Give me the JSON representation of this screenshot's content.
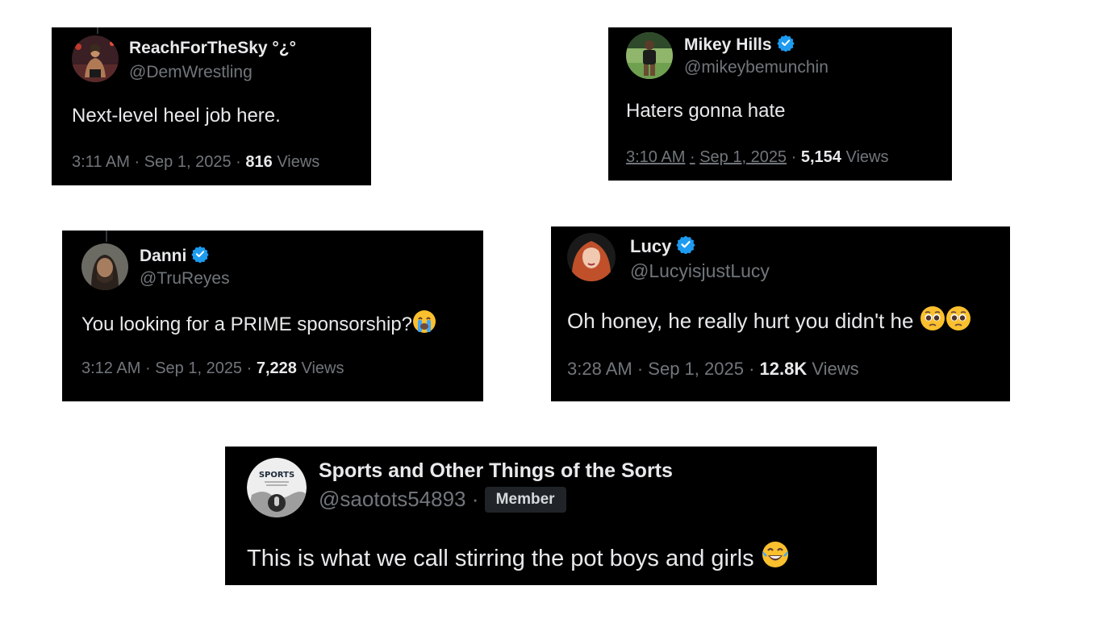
{
  "colors": {
    "card_bg": "#000000",
    "text_primary": "#e7e9ea",
    "text_secondary": "#71767b",
    "verified_blue": "#1d9bf0",
    "page_bg": "#ffffff"
  },
  "tweets": [
    {
      "display_name": "ReachForTheSky °¿°",
      "handle": "@DemWrestling",
      "verified": false,
      "text": "Next-level heel job here.",
      "time": "3:11 AM",
      "date": "Sep 1, 2025",
      "views_count": "816",
      "views_label": "Views"
    },
    {
      "display_name": "Mikey Hills",
      "handle": "@mikeybemunchin",
      "verified": true,
      "text": "Haters gonna hate",
      "time": "3:10 AM",
      "date": "Sep 1, 2025",
      "views_count": "5,154",
      "views_label": "Views"
    },
    {
      "display_name": "Danni",
      "handle": "@TruReyes",
      "verified": true,
      "text": "You looking for a PRIME sponsorship?",
      "emoji": "loudly-crying-face",
      "time": "3:12 AM",
      "date": "Sep 1, 2025",
      "views_count": "7,228",
      "views_label": "Views"
    },
    {
      "display_name": "Lucy",
      "handle": "@LucyisjustLucy",
      "verified": true,
      "text": "Oh honey, he really hurt you didn't he",
      "emoji": "pleading-face x2",
      "time": "3:28 AM",
      "date": "Sep 1, 2025",
      "views_count": "12.8K",
      "views_label": "Views"
    },
    {
      "display_name": "Sports and Other Things of the Sorts",
      "handle": "@saotots54893",
      "badge": "Member",
      "verified": false,
      "text": "This is what we call stirring the pot boys and girls",
      "emoji": "face-with-tears-of-joy",
      "avatar_text": "SPORTS"
    }
  ],
  "separator": "·"
}
